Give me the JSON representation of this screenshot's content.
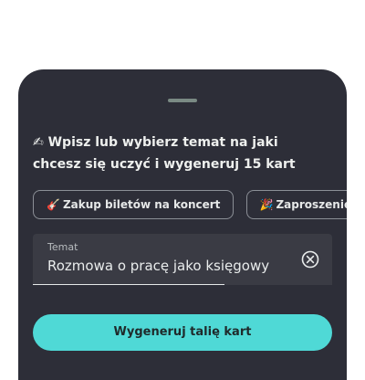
{
  "prompt": {
    "emoji": "✍",
    "text": "Wpisz lub wybierz temat na jaki chcesz się uczyć i wygeneruj 15 kart"
  },
  "suggestions": [
    {
      "emoji": "🎸",
      "label": "Zakup biletów na koncert"
    },
    {
      "emoji": "🎉",
      "label": "Zaproszenie na"
    }
  ],
  "topic_field": {
    "label": "Temat",
    "value": "Rozmowa o pracę jako księgowy"
  },
  "generate_button": {
    "label": "Wygeneruj talię kart"
  },
  "colors": {
    "sheet_bg": "#2d2e38",
    "accent": "#4fd9d6"
  }
}
